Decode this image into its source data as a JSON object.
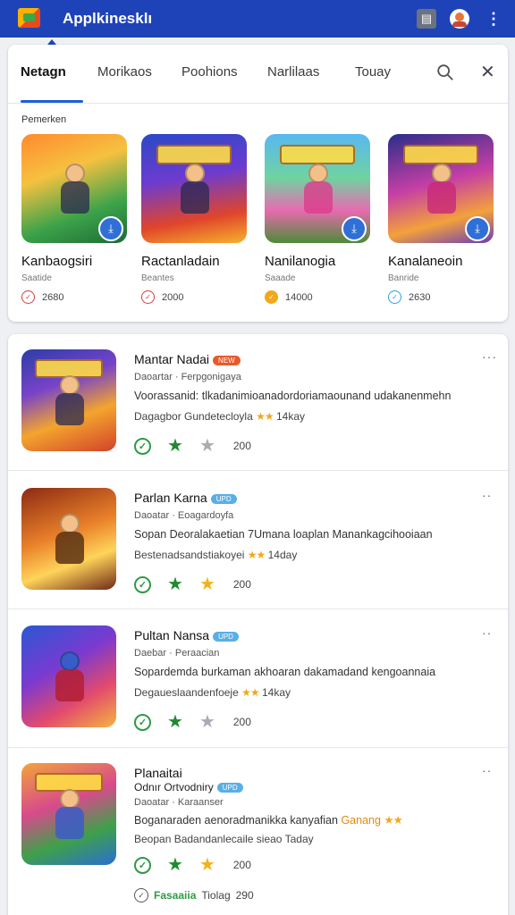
{
  "app": {
    "title": "Applkinesklı"
  },
  "icons": {
    "logo": "app-logo-icon",
    "cast": "cast-icon",
    "avatar": "avatar-icon",
    "more": "more-vertical-icon",
    "search": "search-icon",
    "close": "close-icon"
  },
  "colors": {
    "appbar": "#1e43b8",
    "accent": "#1e5fd8",
    "star": "#f1a81a",
    "green": "#2e9a44"
  },
  "tabs": [
    {
      "label": "Netagn",
      "active": true
    },
    {
      "label": "Morikaos"
    },
    {
      "label": "Poohions"
    },
    {
      "label": "Narlilaas"
    },
    {
      "label": "Touay"
    }
  ],
  "featured": {
    "label": "Pemerken",
    "items": [
      {
        "title": "Kanbaogsiri",
        "sub": "Saatide",
        "rating": "2680"
      },
      {
        "title": "Ractanladain",
        "sub": "Beantes",
        "rating": "2000"
      },
      {
        "title": "Nanilanogia",
        "sub": "Saaade",
        "rating": "14000"
      },
      {
        "title": "Kanalaneoin",
        "sub": "Banride",
        "rating": "2630"
      }
    ]
  },
  "list": [
    {
      "title": "Mantar Nadai",
      "chip": "NEW",
      "meta": "Daoartar  ·  Ferpgonigaya",
      "desc": "Voorassanid: tlkadanimioanadordoriamaounand udakanenmehn",
      "sub": "Dagagbor Gundetecloyla",
      "sub_stars": "★★",
      "sub_extra": "14kay",
      "count": "200"
    },
    {
      "title": "Parlan Karna",
      "chip": "UPD",
      "meta": "Daoatar  ·  Eoagardoyfa",
      "desc": "Sopan Deoralakaetian 7Umana loaplan Manankagcihooiaan",
      "sub": "Bestenadsandstiakoyei",
      "sub_stars": "★★",
      "sub_extra": "14day",
      "count": "200"
    },
    {
      "title": "Pultan Nansa",
      "chip": "UPD",
      "meta": "Daebar  ·  Peraacian",
      "desc": "Sopardemda burkaman akhoaran dakamadand kengoannaia",
      "sub": "Degaueslaandenfoeje",
      "sub_stars": "★★",
      "sub_extra": "14kay",
      "count": "200"
    },
    {
      "title": "Planaitai",
      "title2": "Odnır Ortvodniry",
      "chip": "UPD",
      "meta": "Daoatar  ·  Karaanser",
      "desc": "Boganaraden aenoradmanikka kanyafian",
      "desc_highlight": "Ganang",
      "sub": "Beopan Badandanlecaile sieao",
      "sub_extra": "Taday",
      "count": "200"
    }
  ],
  "footer": {
    "brand": "Fasaaiia",
    "mid": "Tiolag",
    "count": "290"
  }
}
